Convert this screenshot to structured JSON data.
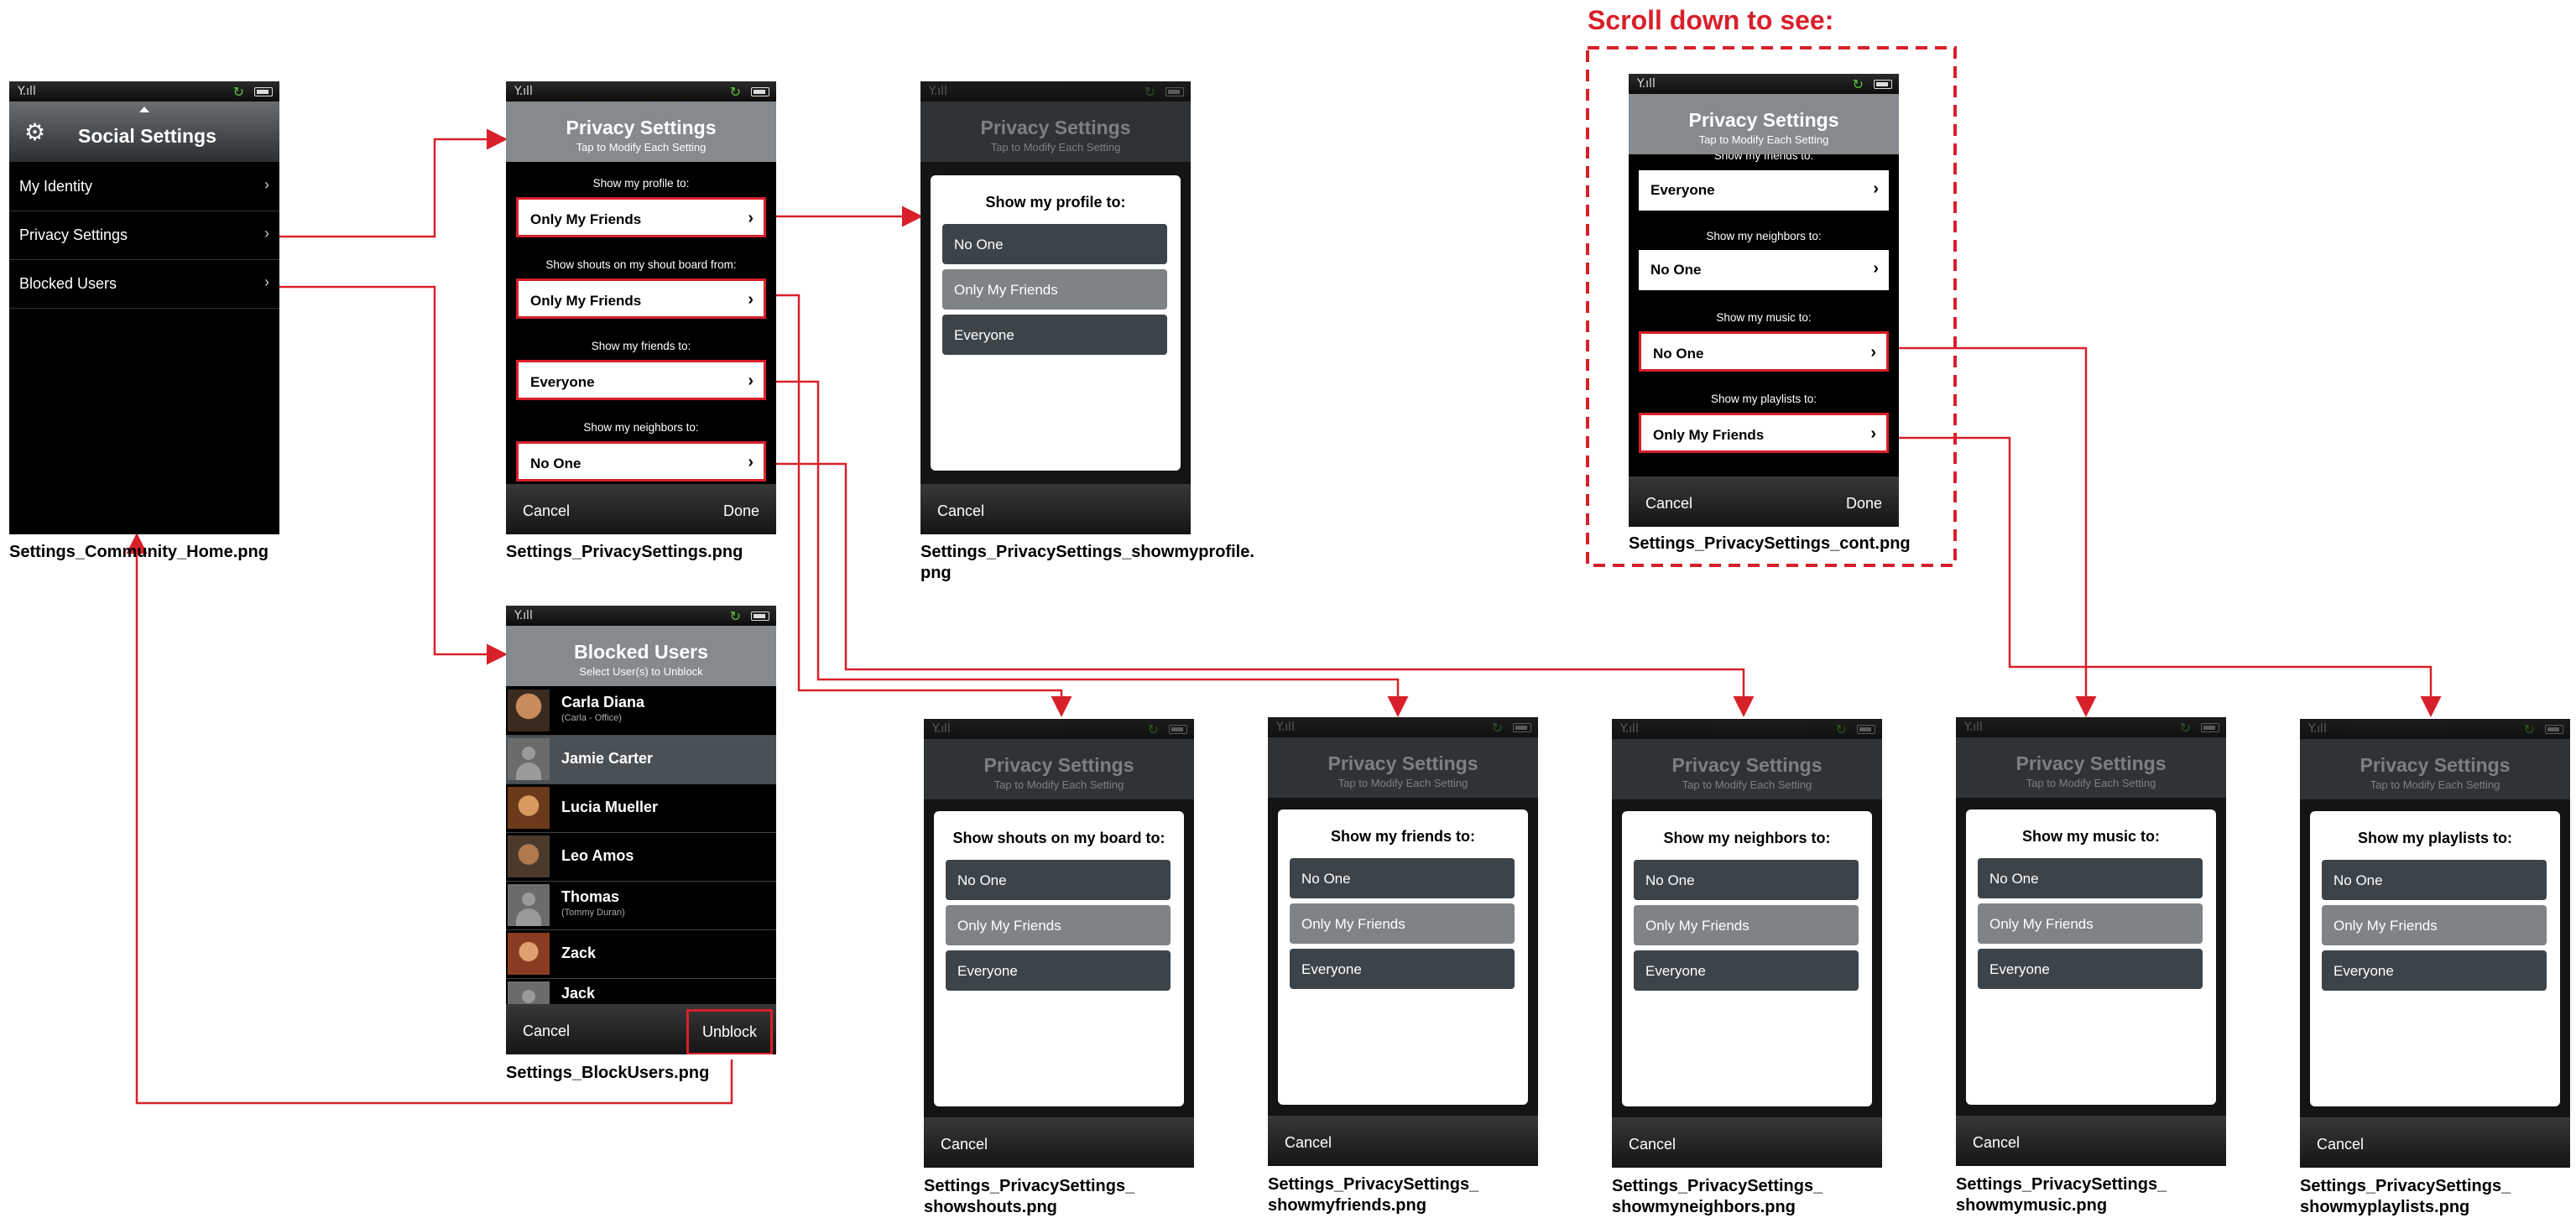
{
  "status_bar": {
    "signal": "Y.ıll",
    "sync": "↻"
  },
  "scroll_note": "Scroll down to see:",
  "home": {
    "title": "Social Settings",
    "items": [
      {
        "label": "My Identity"
      },
      {
        "label": "Privacy Settings"
      },
      {
        "label": "Blocked Users"
      }
    ],
    "caption": "Settings_Community_Home.png"
  },
  "privacy": {
    "title": "Privacy Settings",
    "subtitle": "Tap to Modify Each Setting",
    "rows": [
      {
        "label": "Show my profile to:",
        "value": "Only My Friends"
      },
      {
        "label": "Show shouts on my shout board from:",
        "value": "Only My Friends"
      },
      {
        "label": "Show my friends to:",
        "value": "Everyone"
      },
      {
        "label": "Show my neighbors to:",
        "value": "No One"
      }
    ],
    "cancel": "Cancel",
    "done": "Done",
    "caption": "Settings_PrivacySettings.png"
  },
  "privacy_cont": {
    "title": "Privacy Settings",
    "subtitle": "Tap to Modify Each Setting",
    "partial_label": "Show my friends to:",
    "rows": [
      {
        "label": "",
        "value": "Everyone"
      },
      {
        "label": "Show my neighbors to:",
        "value": "No One"
      },
      {
        "label": "Show my music to:",
        "value": "No One"
      },
      {
        "label": "Show my playlists to:",
        "value": "Only My Friends"
      }
    ],
    "cancel": "Cancel",
    "done": "Done",
    "caption": "Settings_PrivacySettings_cont.png"
  },
  "options": [
    "No One",
    "Only My Friends",
    "Everyone"
  ],
  "dialogs": [
    {
      "question": "Show my profile to:",
      "caption": "Settings_PrivacySettings_showmyprofile.\npng"
    },
    {
      "question": "Show shouts on my board to:",
      "caption": "Settings_PrivacySettings_\nshowshouts.png"
    },
    {
      "question": "Show my friends to:",
      "caption": "Settings_PrivacySettings_\nshowmyfriends.png"
    },
    {
      "question": "Show my neighbors to:",
      "caption": "Settings_PrivacySettings_\nshowmyneighbors.png"
    },
    {
      "question": "Show my music to:",
      "caption": "Settings_PrivacySettings_\nshowmymusic.png"
    },
    {
      "question": "Show my playlists to:",
      "caption": "Settings_PrivacySettings_\nshowmyplaylists.png"
    }
  ],
  "dialog_cancel": "Cancel",
  "blocked": {
    "title": "Blocked Users",
    "subtitle": "Select User(s) to Unblock",
    "users": [
      {
        "name": "Carla Diana",
        "sub": "(Carla - Office)"
      },
      {
        "name": "Jamie Carter",
        "sub": ""
      },
      {
        "name": "Lucia Mueller",
        "sub": ""
      },
      {
        "name": "Leo Amos",
        "sub": ""
      },
      {
        "name": "Thomas",
        "sub": "(Tommy Duran)"
      },
      {
        "name": "Zack",
        "sub": ""
      },
      {
        "name": "Jack",
        "sub": ""
      }
    ],
    "cancel": "Cancel",
    "unblock": "Unblock",
    "caption": "Settings_BlockUsers.png"
  },
  "colors": {
    "accent": "#d8202a",
    "header": "#848a8d",
    "option": "#3d4449",
    "option_selected": "#7e8386",
    "sync": "#5fbf3a"
  }
}
